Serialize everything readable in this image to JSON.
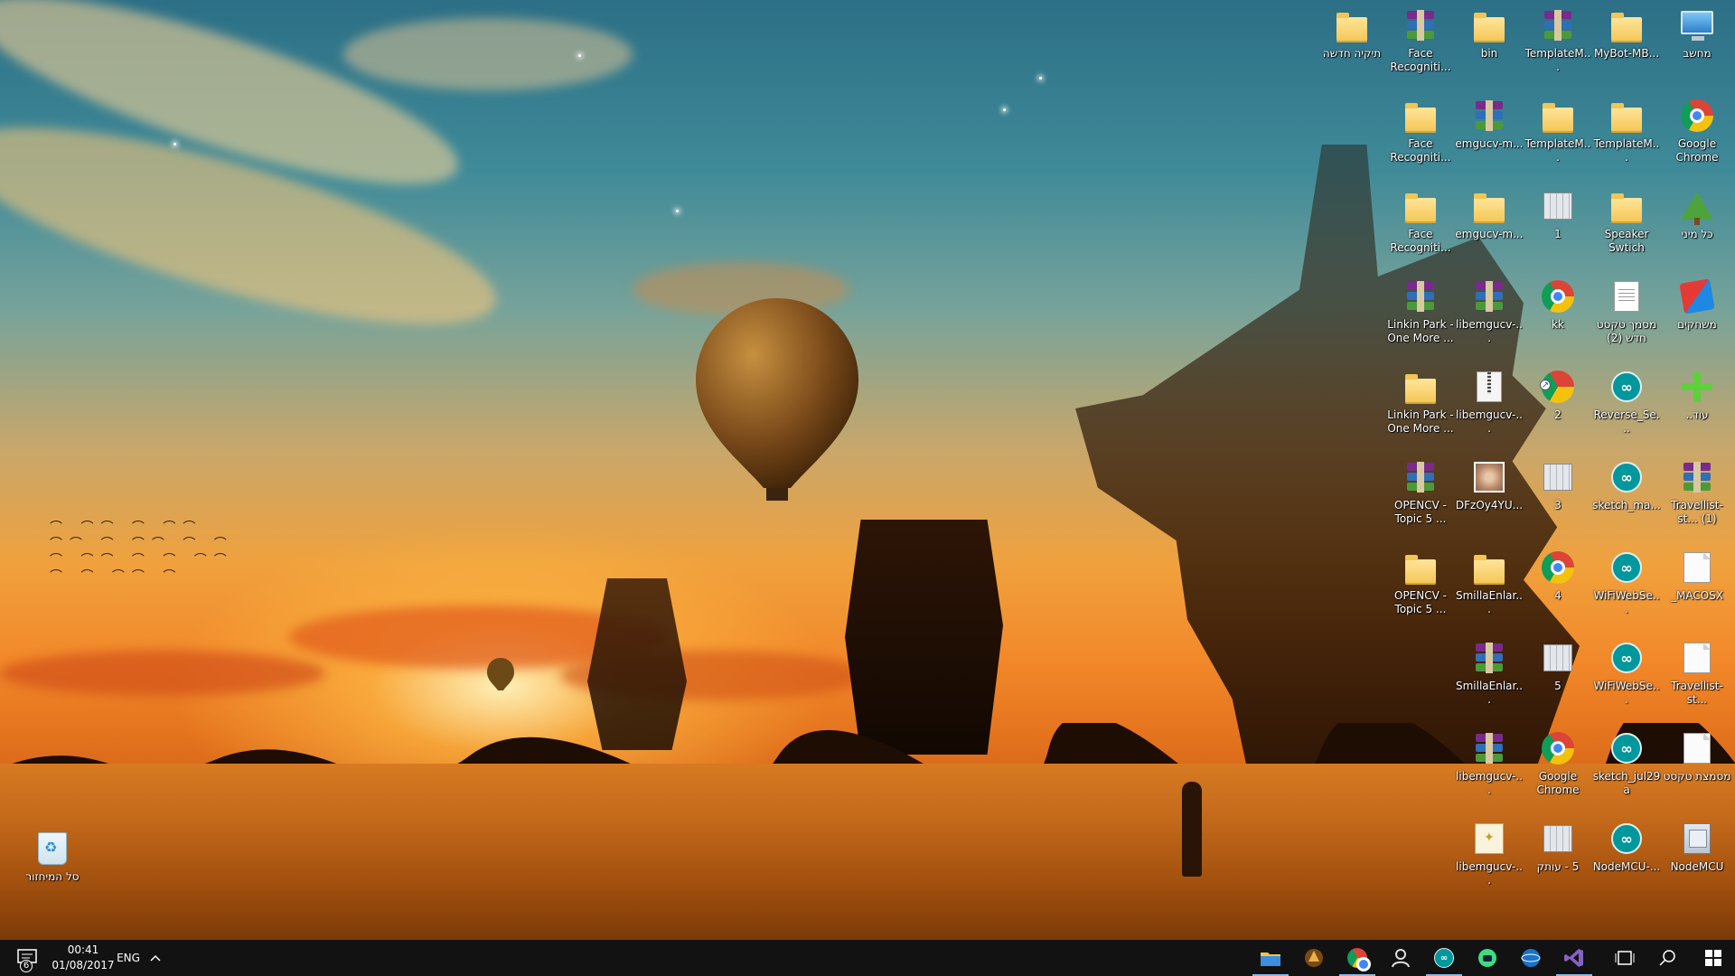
{
  "desktop": {
    "icons": [
      {
        "id": "new-folder",
        "label": "תיקיה חדשה",
        "type": "folder"
      },
      {
        "id": "face-recognition-rar-1",
        "label": "Face Recogniti...",
        "type": "rar"
      },
      {
        "id": "bin-folder",
        "label": "bin",
        "type": "folder-doc"
      },
      {
        "id": "templatem-rar",
        "label": "TemplateM...",
        "type": "rar"
      },
      {
        "id": "mybot-folder",
        "label": "MyBot-MB...",
        "type": "folder"
      },
      {
        "id": "this-pc",
        "label": "מחשב",
        "type": "computer"
      },
      {
        "id": "face-recognition-folder-1",
        "label": "Face Recogniti...",
        "type": "folder"
      },
      {
        "id": "emgucv-rar-1",
        "label": "emgucv-m...",
        "type": "rar"
      },
      {
        "id": "templatem-folder-1",
        "label": "TemplateM...",
        "type": "folder"
      },
      {
        "id": "templatem-folder-2",
        "label": "TemplateM...",
        "type": "folder"
      },
      {
        "id": "google-chrome-1",
        "label": "Google Chrome",
        "type": "chrome"
      },
      {
        "id": "face-recognition-folder-2",
        "label": "Face Recogniti...",
        "type": "folder"
      },
      {
        "id": "emgucv-folder",
        "label": "emgucv-m...",
        "type": "folder"
      },
      {
        "id": "file-1",
        "label": "1",
        "type": "calc"
      },
      {
        "id": "speaker-switch",
        "label": "Speaker Swtich",
        "type": "folder"
      },
      {
        "id": "kol-mini",
        "label": "כל מיני",
        "type": "tree"
      },
      {
        "id": "linkin-park-rar",
        "label": "Linkin Park - One More ...",
        "type": "rar"
      },
      {
        "id": "libemgucv-rar-1",
        "label": "libemgucv-...",
        "type": "rar"
      },
      {
        "id": "kk",
        "label": "kk",
        "type": "chrome"
      },
      {
        "id": "new-text-doc-2",
        "label": "מסמך טקסט חדש (2)",
        "type": "textdoc"
      },
      {
        "id": "games",
        "label": "משחקים",
        "type": "games"
      },
      {
        "id": "linkin-park-folder",
        "label": "Linkin Park - One More ...",
        "type": "folder"
      },
      {
        "id": "libemgucv-zip",
        "label": "libemgucv-...",
        "type": "zip"
      },
      {
        "id": "file-2",
        "label": "2",
        "type": "chrome-shortcut"
      },
      {
        "id": "reverse-se",
        "label": "Reverse_Se...",
        "type": "arduino"
      },
      {
        "id": "more",
        "label": "עוד..",
        "type": "plus"
      },
      {
        "id": "opencv-topic5-rar",
        "label": "OPENCV - Topic 5 ...",
        "type": "rar"
      },
      {
        "id": "dfzoy4yu",
        "label": "DFzOy4YU...",
        "type": "photo"
      },
      {
        "id": "file-3",
        "label": "3",
        "type": "calc"
      },
      {
        "id": "sketch-ma",
        "label": "sketch_ma...",
        "type": "arduino"
      },
      {
        "id": "travellist-rar",
        "label": "Travellist-st... (1)",
        "type": "rar"
      },
      {
        "id": "opencv-topic5-folder",
        "label": "OPENCV - Topic 5 ...",
        "type": "folder"
      },
      {
        "id": "smillaenlar-folder",
        "label": "SmillaEnlar...",
        "type": "folder"
      },
      {
        "id": "file-4",
        "label": "4",
        "type": "chrome"
      },
      {
        "id": "wifiwebse-1",
        "label": "WiFiWebSe...",
        "type": "arduino"
      },
      {
        "id": "macosx",
        "label": "_MACOSX",
        "type": "paper"
      },
      {
        "id": "smillaenlar-rar",
        "label": "SmillaEnlar...",
        "type": "rar"
      },
      {
        "id": "file-5",
        "label": "5",
        "type": "calc"
      },
      {
        "id": "wifiwebse-2",
        "label": "WiFiWebSe...",
        "type": "arduino"
      },
      {
        "id": "travellist-st",
        "label": "Travellist-st...",
        "type": "paper"
      },
      {
        "id": "libemgucv-rar-2",
        "label": "libemgucv-...",
        "type": "rar"
      },
      {
        "id": "google-chrome-2",
        "label": "Google Chrome",
        "type": "chrome"
      },
      {
        "id": "sketch-jul29a",
        "label": "sketch_jul29a",
        "type": "arduino"
      },
      {
        "id": "text-doc",
        "label": "מסמצת טקסט",
        "type": "paper"
      },
      {
        "id": "libemgucv-cert",
        "label": "libemgucv-...",
        "type": "cert"
      },
      {
        "id": "copy-5",
        "label": "5 - עותק",
        "type": "calc"
      },
      {
        "id": "nodemcu-1",
        "label": "NodeMCU-...",
        "type": "arduino"
      },
      {
        "id": "nodemcu-2",
        "label": "NodeMCU",
        "type": "nodemcu"
      },
      {
        "id": "recycle-bin",
        "label": "סל המיחזור",
        "type": "recycle"
      }
    ]
  },
  "taskbar": {
    "notification_badge": "6",
    "clock_time": "00:41",
    "clock_date": "01/08/2017",
    "language": "ENG",
    "show_hidden_icons": "^",
    "apps": [
      {
        "name": "file-explorer-icon",
        "active": true
      },
      {
        "name": "game-app-icon",
        "active": false
      },
      {
        "name": "chrome-icon",
        "active": true
      },
      {
        "name": "person-app-icon",
        "active": false
      },
      {
        "name": "arduino-icon",
        "active": true
      },
      {
        "name": "android-icon",
        "active": false
      },
      {
        "name": "network-app-icon",
        "active": false
      },
      {
        "name": "visual-studio-icon",
        "active": true
      }
    ]
  },
  "colors": {
    "taskbar_bg": "#121212",
    "active_indicator": "#8fb6e6"
  }
}
